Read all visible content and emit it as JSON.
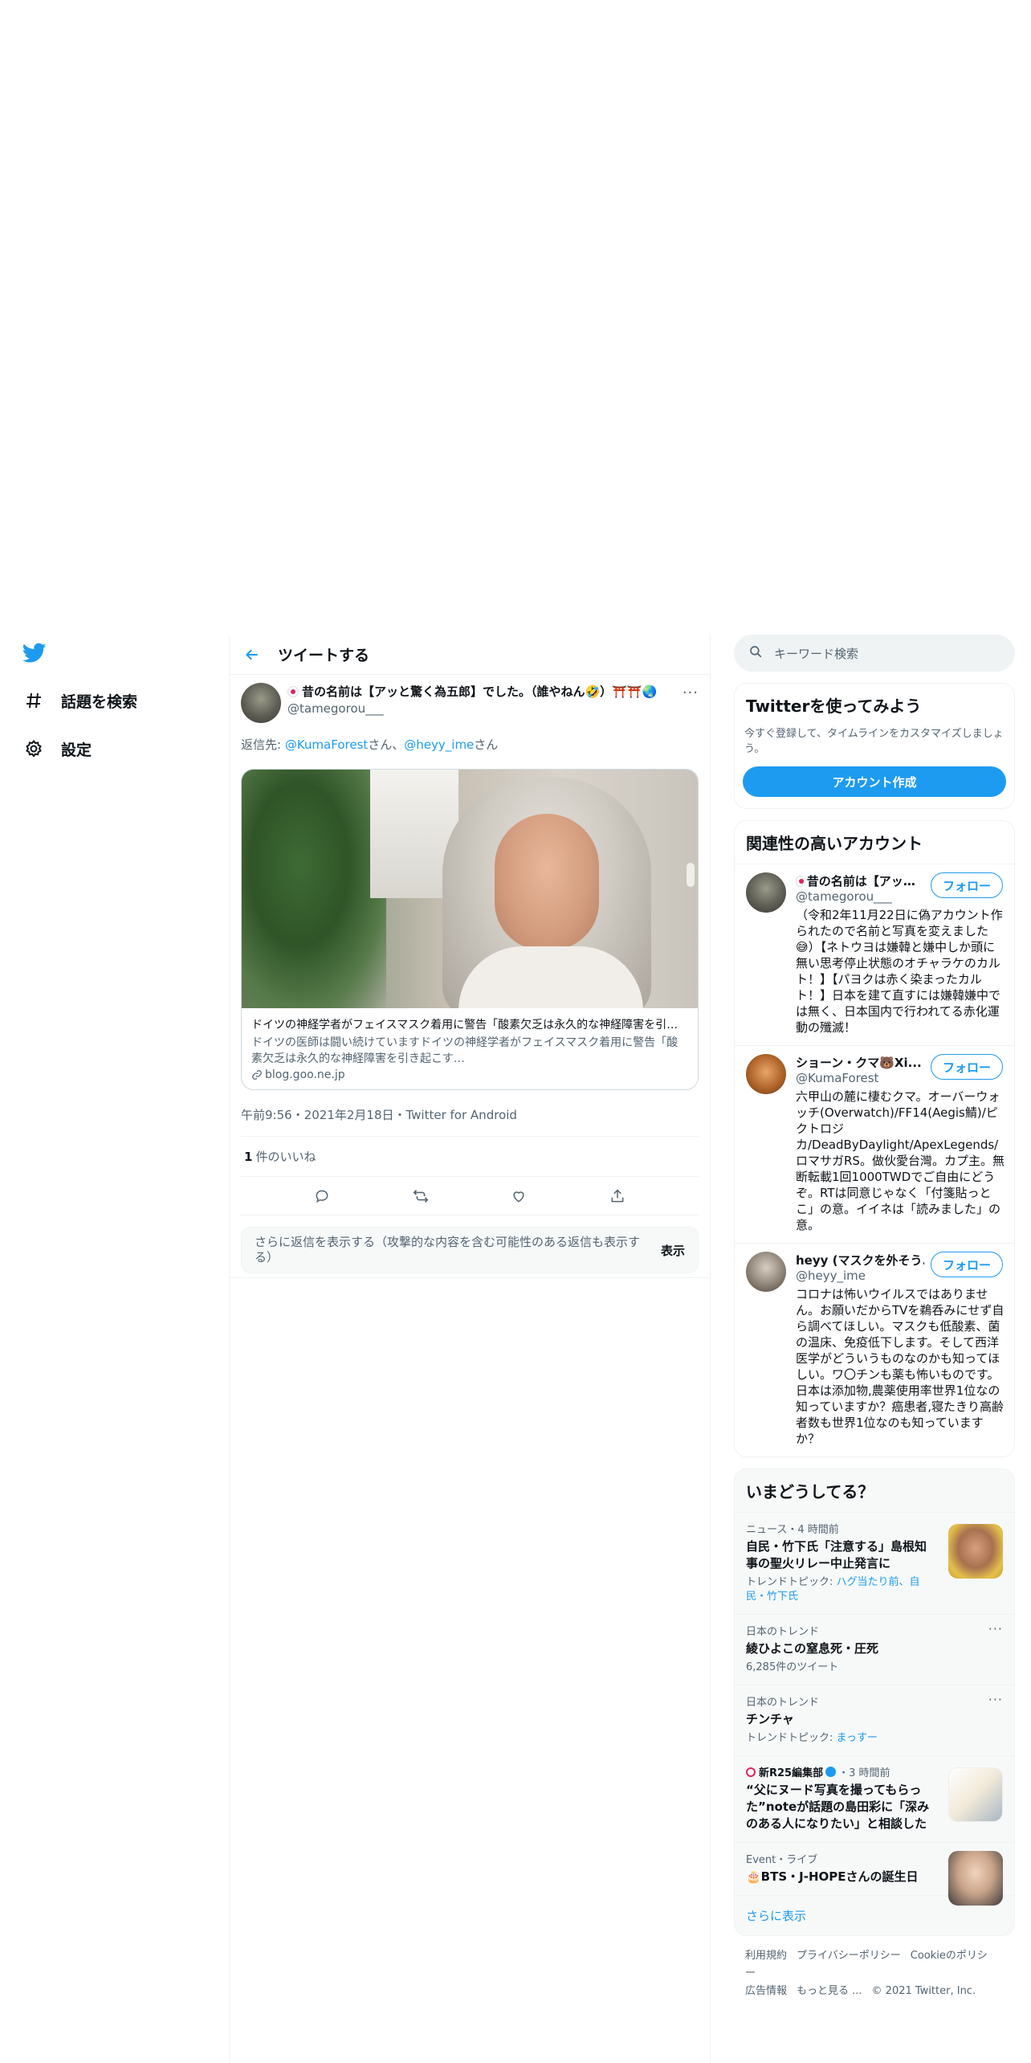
{
  "nav": {
    "explore_label": "話題を検索",
    "settings_label": "設定"
  },
  "header": {
    "title": "ツイートする"
  },
  "tweet": {
    "display_name": "昔の名前は【アッと驚く為五郎】でした。（誰やねん🤣）⛩️⛩️🌏",
    "handle": "@tamegorou___",
    "more": "···",
    "reply_prefix": "返信先: ",
    "reply_mention_1": "@KumaForest",
    "reply_sep_1": "さん、",
    "reply_mention_2": "@heyy_ime",
    "reply_sep_2": "さん",
    "card": {
      "title": "ドイツの神経学者がフェイスマスク着用に警告「酸素欠乏は永久的な神経障害を引き起こす」",
      "description": "ドイツの医師は闘い続けていますドイツの神経学者がフェイスマスク着用に警告「酸素欠乏は永久的な神経障害を引き起こす…",
      "domain": "blog.goo.ne.jp"
    },
    "timestamp": "午前9:56・2021年2月18日・Twitter for Android",
    "likes_count": "1",
    "likes_label": "件のいいね",
    "more_replies_text": "さらに返信を表示する（攻撃的な内容を含む可能性のある返信も表示する）",
    "more_replies_show": "表示"
  },
  "search": {
    "placeholder": "キーワード検索"
  },
  "signup": {
    "title": "Twitterを使ってみよう",
    "description": "今すぐ登録して、タイムラインをカスタマイズしましょう。",
    "button": "アカウント作成"
  },
  "relevant": {
    "title": "関連性の高いアカウント",
    "follow_label": "フォロー",
    "accounts": [
      {
        "name": "昔の名前は【アッと驚く為五郎】",
        "handle": "@tamegorou___",
        "bio": "（令和2年11月22日に偽アカウント作られたので名前と写真を変えました😅）【ネトウヨは嫌韓と嫌中しか頭に無い思考停止状態のオチャラケのカルト！】【パヨクは赤く染まったカルト！】日本を建て直すには嫌韓嫌中では無く、日本国内で行われてる赤化運動の殲滅！"
      },
      {
        "name": "ショーン・クマ🐻Xi...",
        "handle": "@KumaForest",
        "bio": "六甲山の麓に棲むクマ。オーバーウォッチ(Overwatch)/FF14(Aegis鯖)/ピクトロジカ/DeadByDaylight/ApexLegends/ロマサガRS。做伙愛台灣。カプ主。無断転載1回1000TWDでご自由にどうぞ。RTは同意じゃなく「付箋貼っとこ」の意。イイネは「読みました」の意。"
      },
      {
        "name": "heyy (マスクを外そう...",
        "handle": "@heyy_ime",
        "bio": "コロナは怖いウイルスではありません。お願いだからTVを鵜呑みにせず自ら調べてほしい。マスクも低酸素、菌の温床、免疫低下します。そして西洋医学がどういうものなのかも知ってほしい。ワ〇チンも薬も怖いものです。日本は添加物,農薬使用率世界1位なの知っていますか？癌患者,寝たきり高齢者数も世界1位なのも知っていますか？"
      }
    ]
  },
  "trends": {
    "title": "いまどうしてる？",
    "items": [
      {
        "meta": "ニュース・4 時間前",
        "title": "自民・竹下氏「注意する」島根知事の聖火リレー中止発言に",
        "sub_prefix": "トレンドトピック: ",
        "sub_link": "ハグ当たり前、自民・竹下氏"
      },
      {
        "meta": "日本のトレンド",
        "title": "綾ひよこの窒息死・圧死",
        "sub": "6,285件のツイート"
      },
      {
        "meta": "日本のトレンド",
        "title": "チンチャ",
        "sub_prefix": "トレンドトピック: ",
        "sub_link": "まっすー"
      },
      {
        "meta_author": "新R25編集部",
        "meta_time": "・3 時間前",
        "title": "“父にヌード写真を撮ってもらった”noteが話題の島田彩に「深みのある人になりたい」と相談した"
      },
      {
        "meta": "Event・ライブ",
        "title": "🎂BTS・J-HOPEさんの誕生日"
      }
    ],
    "show_more": "さらに表示"
  },
  "footer": {
    "links": [
      "利用規約",
      "プライバシーポリシー",
      "Cookieのポリシー",
      "広告情報",
      "もっと見る ...",
      "© 2021 Twitter, Inc."
    ]
  },
  "colors": {
    "accent": "#1d9bf0",
    "text": "#0f1419",
    "secondary": "#536471",
    "border": "#eff3f4"
  }
}
